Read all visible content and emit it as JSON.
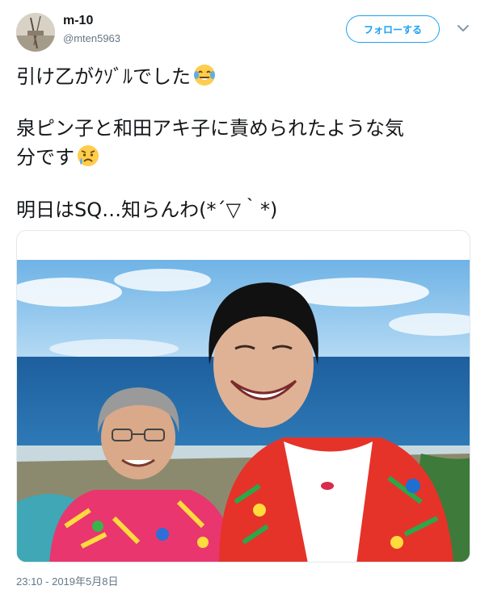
{
  "user": {
    "display_name": "m-10",
    "handle": "@mten5963"
  },
  "actions": {
    "follow_label": "フォローする",
    "more_icon": "chevron-down-icon"
  },
  "tweet": {
    "line1": "引け乙がｸｿﾞﾙでした",
    "line1_emoji": "face-with-tears-of-joy-emoji",
    "line2": "泉ピン子と和田アキ子に責められたような気",
    "line3": "分です",
    "line3_emoji": "sad-but-relieved-face-emoji",
    "line4": "明日はSQ…知らんわ(*´▽｀*)"
  },
  "media": {
    "description_icon": "photo-two-women-hawaiian-shirts"
  },
  "timestamp": "23:10 - 2019年5月8日",
  "colors": {
    "accent": "#1da1f2",
    "secondary_text": "#657786",
    "border": "#e1e8ed"
  }
}
